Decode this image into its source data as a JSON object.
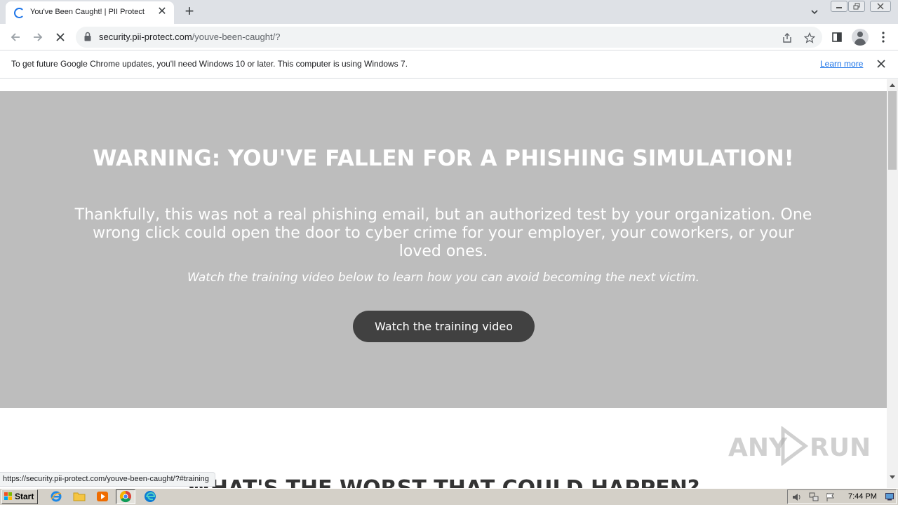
{
  "browser": {
    "tab": {
      "title": "You've Been Caught! | PII Protect",
      "close_glyph": "✕"
    },
    "new_tab_glyph": "+",
    "tab_search_glyph": "⌄",
    "window_controls": {
      "minimize": "▭",
      "restore": "⧉",
      "close": "✕"
    },
    "toolbar": {
      "back_glyph": "←",
      "forward_glyph": "→",
      "stop_glyph": "✕",
      "url_host": "security.pii-protect.com",
      "url_path": "/youve-been-caught/?",
      "share_glyph": "⇪",
      "bookmark_glyph": "☆",
      "sidepanel_glyph": "◧",
      "menu_glyph": "⋮"
    },
    "infobar": {
      "message": "To get future Google Chrome updates, you'll need Windows 10 or later. This computer is using Windows 7.",
      "link_label": "Learn more",
      "close_glyph": "✕"
    },
    "status_url": "https://security.pii-protect.com/youve-been-caught/?#training"
  },
  "page": {
    "heading": "WARNING: YOU'VE FALLEN FOR A PHISHING SIMULATION!",
    "lead": "Thankfully, this was not a real phishing email, but an authorized test by your organization. One wrong click could open the door to cyber crime for your employer, your coworkers, or your loved ones.",
    "subtext": "Watch the training video below to learn how you can avoid becoming the next victim.",
    "cta_label": "Watch the training video",
    "next_heading": "WHAT'S THE WORST THAT COULD HAPPEN?",
    "colors": {
      "hero_bg": "#bdbdbd",
      "button_bg": "#414141"
    }
  },
  "watermark": {
    "left": "ANY",
    "right": "RUN"
  },
  "taskbar": {
    "start_label": "Start",
    "apps": [
      "internet-explorer-icon",
      "file-explorer-icon",
      "media-player-icon",
      "chrome-icon",
      "edge-icon"
    ],
    "clock": "7:44 PM"
  }
}
